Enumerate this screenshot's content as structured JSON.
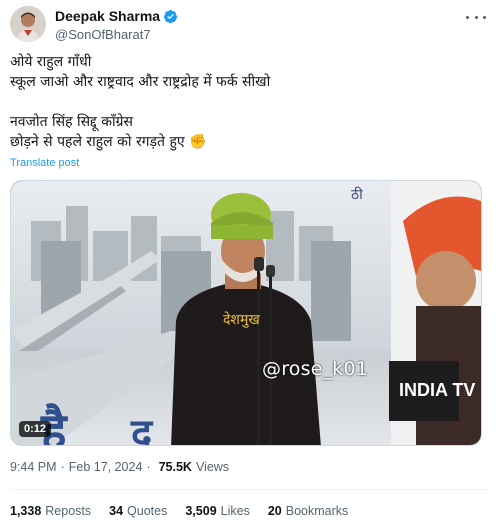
{
  "author": {
    "display_name": "Deepak Sharma",
    "handle": "@SonOfBharat7",
    "verified": true
  },
  "tweet": {
    "lines": [
      "ओये राहुल गाँधी",
      "स्कूल जाओ और राष्ट्रवाद और राष्ट्रद्रोह में फर्क सीखो",
      "",
      "नवजोत सिंह सिद्दू कॉंग्रेस",
      "छोड़ने से पहले राहुल को रगड़ते हुए ✊"
    ],
    "translate_label": "Translate post"
  },
  "media": {
    "duration": "0:12",
    "caption_overlay": "देशमुख",
    "watermark": "@rose_k01",
    "channel_logo": "INDIA TV"
  },
  "meta": {
    "time": "9:44 PM",
    "date": "Feb 17, 2024",
    "views_count": "75.5K",
    "views_label": "Views"
  },
  "stats": {
    "reposts": {
      "count": "1,338",
      "label": "Reposts"
    },
    "quotes": {
      "count": "34",
      "label": "Quotes"
    },
    "likes": {
      "count": "3,509",
      "label": "Likes"
    },
    "bookmarks": {
      "count": "20",
      "label": "Bookmarks"
    }
  },
  "colors": {
    "link": "#1d9bf0",
    "secondary_text": "#536471",
    "turban": "#9bbf3a"
  },
  "icons": {
    "verified": "verified-badge-icon",
    "more": "more-options-icon"
  }
}
